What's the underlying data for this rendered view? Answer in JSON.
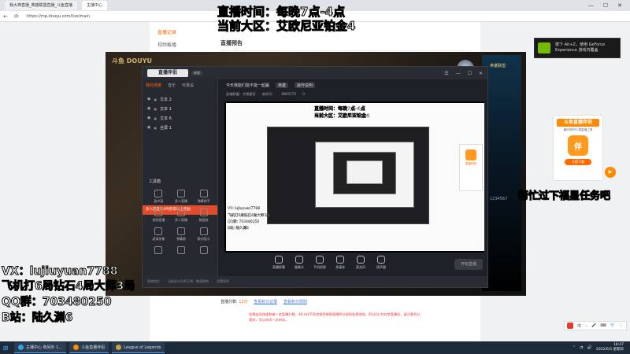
{
  "browser": {
    "tabs": [
      "我大神直播_英雄联盟直播_斗鱼直播",
      "主播中心"
    ],
    "url": "https://mp.douyu.com/live/main",
    "controls": [
      "—",
      "☐",
      "✕"
    ]
  },
  "page": {
    "sidebar": [
      "直播记录",
      "视频截播"
    ],
    "heading": "直播预告",
    "stream_info": {
      "label": "直播分数:",
      "score": "12分",
      "link1": "查看积分记录",
      "link2": "查看积分规则",
      "note": "如果出现违规和被一定直播分数，48小时不再违规将按照直播积分规则处理违规，积分0分为封禁直播间，请注意积分规则，可以申诉一次申诉。"
    }
  },
  "game": {
    "banner": "斗鱼 DOUYU",
    "side_top": "英雄联盟",
    "side_bottom": "1234567"
  },
  "app": {
    "logo": "直播伴侣",
    "version": "新版",
    "top_icons": [
      "☰",
      "—",
      "☐",
      "✕"
    ],
    "left_tabs": [
      "我的场景",
      "音乐",
      "可靠设"
    ],
    "scenes": [
      "文本 2",
      "文本 1",
      "文本 6",
      "全屏 1"
    ],
    "toolbox_title": "工具箱",
    "tools": [
      "画中画",
      "多人直播",
      "弹幕助手",
      "视频直播",
      "多人直播",
      "数据排",
      "虚拟形象",
      "弹幕姬",
      "歌词显示",
      "",
      "",
      ""
    ],
    "promo_strip": "多人连麦3小时获得以上奖励",
    "status": [
      "网络良好",
      "当前显卡功率正常，敬请期待",
      "设置帧率"
    ],
    "header_title": "今天我能们能不能一起赢",
    "header_tag": "英雄",
    "header_tag2": "操作说明",
    "header_row2": [
      "英雄联盟：大铸星官",
      "房间号：",
      "6805175",
      "0"
    ],
    "overlay_time": "直播时间：每晚7点-4点",
    "overlay_area": "当前大区：艾欧尼亚铂金4",
    "mini_overlay": [
      "VX: lujiuyuan7788",
      "飞机打6局钻石4局大师3局",
      "QQ群: 703480250",
      "B站: 陆久渊6"
    ],
    "mini_promo": "直播伴侣",
    "bottom_tools": [
      "直播屏幕",
      "摄像头",
      "手机投屏",
      "多媒体",
      "麦克风",
      "扬声器"
    ],
    "start_live": "开始直播"
  },
  "overlays": {
    "top_time": "直播时间：每晚7点-4点",
    "top_area": "当前大区：艾欧尼亚铂金4",
    "vx": "VX：lujiuyuan7788",
    "games": "飞机打6局钻石4局大师3局",
    "qq": "QQ群：703480250",
    "bilibili": "B站：陆久渊6",
    "mission": "帮忙过下福星任务吧"
  },
  "widgets": {
    "gf_toast_line1": "按下 Alt+Z，使用 GeForce",
    "gf_toast_line2": "Experience 游戏内覆盖",
    "promo_title": "斗鱼直播伴侣",
    "promo_sub": "最好用的PC端直播工具",
    "promo_icon_text": "伴",
    "promo_btn": "立即下载",
    "play": "▶"
  },
  "ime": [
    "中",
    "·,",
    "🎤",
    "⌨",
    "👕",
    "⋮"
  ],
  "taskbar": {
    "apps": [
      "主播中心 和另外 1...",
      "斗鱼直播伴侣",
      "League of Legends"
    ],
    "time": "18:47",
    "date": "2022/6/5 星期日"
  }
}
